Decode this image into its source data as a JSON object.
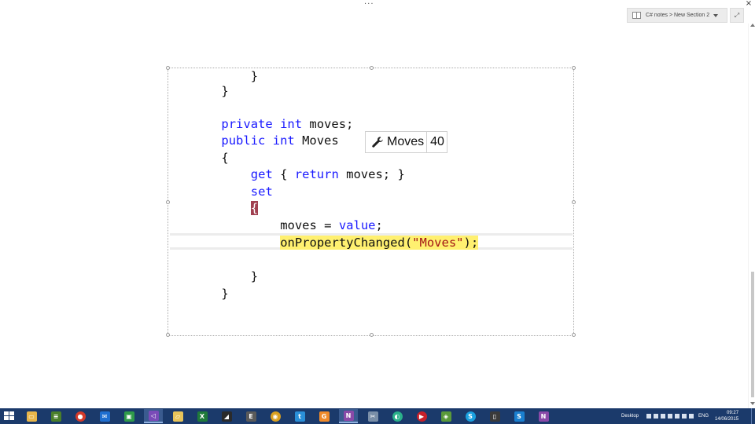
{
  "window": {
    "menu_dots": "···",
    "close_glyph": "×"
  },
  "notebook": {
    "path": "C# notes > New Section 2",
    "expand_glyph": "⤢"
  },
  "code_lines": [
    {
      "indent": 8,
      "segments": [
        {
          "t": "}",
          "c": ""
        }
      ]
    },
    {
      "indent": 4,
      "segments": [
        {
          "t": "}",
          "c": ""
        }
      ]
    },
    {
      "indent": 0,
      "segments": []
    },
    {
      "indent": 4,
      "segments": [
        {
          "t": "private",
          "c": "kw"
        },
        {
          "t": " ",
          "c": ""
        },
        {
          "t": "int",
          "c": "kw"
        },
        {
          "t": " moves;",
          "c": ""
        }
      ]
    },
    {
      "indent": 4,
      "segments": [
        {
          "t": "public",
          "c": "kw"
        },
        {
          "t": " ",
          "c": ""
        },
        {
          "t": "int",
          "c": "kw"
        },
        {
          "t": " Moves",
          "c": ""
        }
      ]
    },
    {
      "indent": 4,
      "segments": [
        {
          "t": "{",
          "c": ""
        }
      ]
    },
    {
      "indent": 8,
      "segments": [
        {
          "t": "get",
          "c": "kw"
        },
        {
          "t": " { ",
          "c": ""
        },
        {
          "t": "return",
          "c": "kw"
        },
        {
          "t": " moves; }",
          "c": ""
        }
      ]
    },
    {
      "indent": 8,
      "segments": [
        {
          "t": "set",
          "c": "kw"
        }
      ]
    },
    {
      "indent": 8,
      "segments": [
        {
          "t": "{",
          "c": "brace-hl"
        }
      ]
    },
    {
      "indent": 12,
      "segments": [
        {
          "t": "moves = ",
          "c": ""
        },
        {
          "t": "value",
          "c": "kw"
        },
        {
          "t": ";",
          "c": ""
        }
      ]
    },
    {
      "indent": 12,
      "segments": [
        {
          "t": "onPropertyChanged(",
          "c": "exec-hl"
        },
        {
          "t": "\"Moves\"",
          "c": "exec-hl str"
        },
        {
          "t": ");",
          "c": "exec-hl"
        }
      ]
    },
    {
      "indent": 0,
      "segments": []
    },
    {
      "indent": 8,
      "segments": [
        {
          "t": "}",
          "c": ""
        }
      ]
    },
    {
      "indent": 4,
      "segments": [
        {
          "t": "}",
          "c": ""
        }
      ]
    }
  ],
  "datatip": {
    "icon": "wrench-icon",
    "name": "Moves",
    "value": "40"
  },
  "taskbar": {
    "apps": [
      {
        "name": "file-explorer",
        "glyph": "▭",
        "color": "#e8b64a",
        "round": false,
        "active": false
      },
      {
        "name": "stacked-app",
        "glyph": "≡",
        "color": "#4a7f2a",
        "round": false,
        "active": false
      },
      {
        "name": "circle-app",
        "glyph": "●",
        "color": "#d43a2a",
        "round": true,
        "active": false
      },
      {
        "name": "mail",
        "glyph": "✉",
        "color": "#1f6fd0",
        "round": false,
        "active": false
      },
      {
        "name": "store",
        "glyph": "▣",
        "color": "#2f9a4a",
        "round": false,
        "active": false
      },
      {
        "name": "visual-studio",
        "glyph": "◁",
        "color": "#7a4bb8",
        "round": false,
        "active": true
      },
      {
        "name": "folder",
        "glyph": "▱",
        "color": "#e8c45a",
        "round": false,
        "active": false
      },
      {
        "name": "excel",
        "glyph": "X",
        "color": "#1f7a3a",
        "round": false,
        "active": false
      },
      {
        "name": "dark-app",
        "glyph": "◢",
        "color": "#2a2a2a",
        "round": false,
        "active": false
      },
      {
        "name": "evernote",
        "glyph": "E",
        "color": "#5a5a5a",
        "round": false,
        "active": false
      },
      {
        "name": "chrome",
        "glyph": "◉",
        "color": "#d9a020",
        "round": true,
        "active": false
      },
      {
        "name": "twitter",
        "glyph": "t",
        "color": "#2a8fd8",
        "round": false,
        "active": false
      },
      {
        "name": "orange-app",
        "glyph": "G",
        "color": "#f08a2a",
        "round": false,
        "active": false
      },
      {
        "name": "onenote",
        "glyph": "N",
        "color": "#8a4aa8",
        "round": false,
        "active": true
      },
      {
        "name": "snip-tool",
        "glyph": "✂",
        "color": "#7a8fa8",
        "round": false,
        "active": false
      },
      {
        "name": "globe-app",
        "glyph": "◐",
        "color": "#2ab08a",
        "round": true,
        "active": false
      },
      {
        "name": "media-app",
        "glyph": "▶",
        "color": "#c8202a",
        "round": true,
        "active": false
      },
      {
        "name": "green-app",
        "glyph": "◈",
        "color": "#5a9a3a",
        "round": false,
        "active": false
      },
      {
        "name": "skype",
        "glyph": "S",
        "color": "#1aa0e0",
        "round": true,
        "active": false
      },
      {
        "name": "phone-app",
        "glyph": "▯",
        "color": "#3a3a3a",
        "round": false,
        "active": false
      },
      {
        "name": "skype-business",
        "glyph": "S",
        "color": "#1a7fd0",
        "round": false,
        "active": false
      },
      {
        "name": "onenote-2",
        "glyph": "N",
        "color": "#8a4aa8",
        "round": false,
        "active": false
      }
    ],
    "desktop_label": "Desktop",
    "lang": "ENG",
    "time": "09:27",
    "date": "14/06/2015"
  }
}
